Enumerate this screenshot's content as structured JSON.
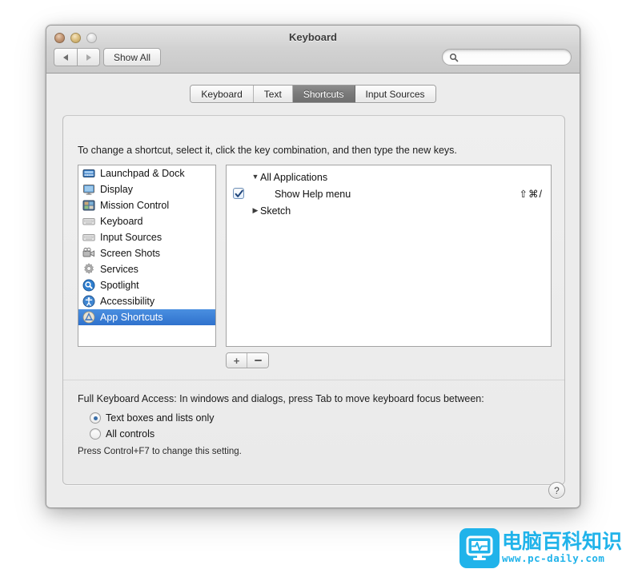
{
  "window": {
    "title": "Keyboard",
    "traffic_lights": [
      "close-button",
      "minimize-button",
      "zoom-button"
    ]
  },
  "toolbar": {
    "back_label": "◀",
    "forward_label": "▶",
    "show_all_label": "Show All",
    "search": {
      "value": "",
      "placeholder": ""
    }
  },
  "tabs": [
    {
      "label": "Keyboard",
      "selected": false
    },
    {
      "label": "Text",
      "selected": false
    },
    {
      "label": "Shortcuts",
      "selected": true
    },
    {
      "label": "Input Sources",
      "selected": false
    }
  ],
  "main": {
    "instruction": "To change a shortcut, select it, click the key combination, and then type the new keys.",
    "categories": [
      {
        "label": "Launchpad & Dock",
        "icon": "launchpad-dock-icon",
        "selected": false
      },
      {
        "label": "Display",
        "icon": "display-icon",
        "selected": false
      },
      {
        "label": "Mission Control",
        "icon": "mission-control-icon",
        "selected": false
      },
      {
        "label": "Keyboard",
        "icon": "keyboard-icon",
        "selected": false
      },
      {
        "label": "Input Sources",
        "icon": "input-sources-icon",
        "selected": false
      },
      {
        "label": "Screen Shots",
        "icon": "screen-shots-icon",
        "selected": false
      },
      {
        "label": "Services",
        "icon": "services-gear-icon",
        "selected": false
      },
      {
        "label": "Spotlight",
        "icon": "spotlight-icon",
        "selected": false
      },
      {
        "label": "Accessibility",
        "icon": "accessibility-icon",
        "selected": false
      },
      {
        "label": "App Shortcuts",
        "icon": "app-shortcuts-icon",
        "selected": true
      }
    ],
    "shortcut_tree": [
      {
        "label": "All Applications",
        "type": "group",
        "expanded": true,
        "disclosure": "▼",
        "key": ""
      },
      {
        "label": "Show Help menu",
        "type": "item",
        "checked": true,
        "key": "⇧⌘/"
      },
      {
        "label": "Sketch",
        "type": "group",
        "expanded": false,
        "disclosure": "▶",
        "key": ""
      }
    ],
    "add_label": "+",
    "remove_label": "–"
  },
  "full_keyboard_access": {
    "title": "Full Keyboard Access: In windows and dialogs, press Tab to move keyboard focus between:",
    "options": [
      {
        "label": "Text boxes and lists only",
        "selected": true
      },
      {
        "label": "All controls",
        "selected": false
      }
    ],
    "note": "Press Control+F7 to change this setting."
  },
  "help_button_label": "?",
  "watermark": {
    "text_cn": "电脑百科知识",
    "url": "www.pc-daily.com",
    "color": "#20b3ea"
  },
  "colors": {
    "selection_blue": "#2f72cd",
    "tab_selected": "#797979",
    "window_bg": "#ececec"
  }
}
